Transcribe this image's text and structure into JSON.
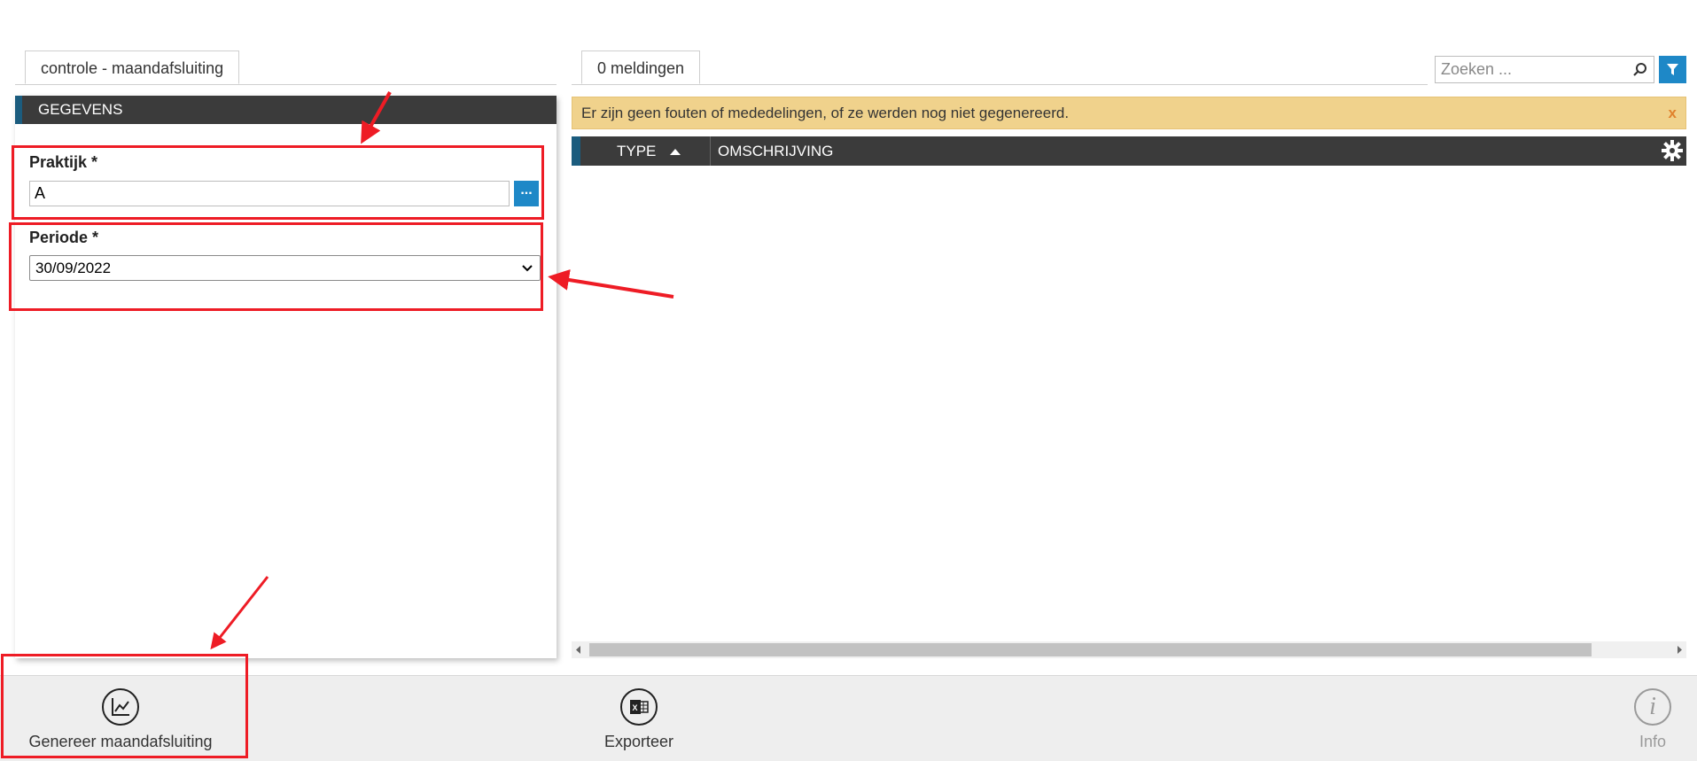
{
  "left_tab": {
    "label": "controle - maandafsluiting"
  },
  "right_tab": {
    "label": "0 meldingen"
  },
  "section": {
    "title": "GEGEVENS"
  },
  "praktijk": {
    "label": "Praktijk *",
    "value": "A",
    "lookup_label": "..."
  },
  "periode": {
    "label": "Periode *",
    "value": "30/09/2022"
  },
  "search": {
    "placeholder": "Zoeken ..."
  },
  "alert": {
    "message": "Er zijn geen fouten of mededelingen, of ze werden nog niet gegenereerd.",
    "close_label": "x"
  },
  "grid": {
    "columns": [
      "TYPE",
      "OMSCHRIJVING"
    ],
    "sort_column": "TYPE",
    "sort_direction": "asc"
  },
  "footer": {
    "generate_label": "Genereer maandafsluiting",
    "export_label": "Exporteer",
    "info_label": "Info"
  },
  "colors": {
    "accent": "#1e88c7",
    "header_bg": "#3b3b3b",
    "header_stripe": "#1b5c7e",
    "alert_bg": "#f0d28c",
    "annotation_red": "#ee1c25"
  },
  "icons": [
    "search-icon",
    "filter-icon",
    "gear-icon",
    "sort-asc-icon",
    "chevron-down-icon",
    "line-chart-icon",
    "excel-icon",
    "info-icon"
  ]
}
